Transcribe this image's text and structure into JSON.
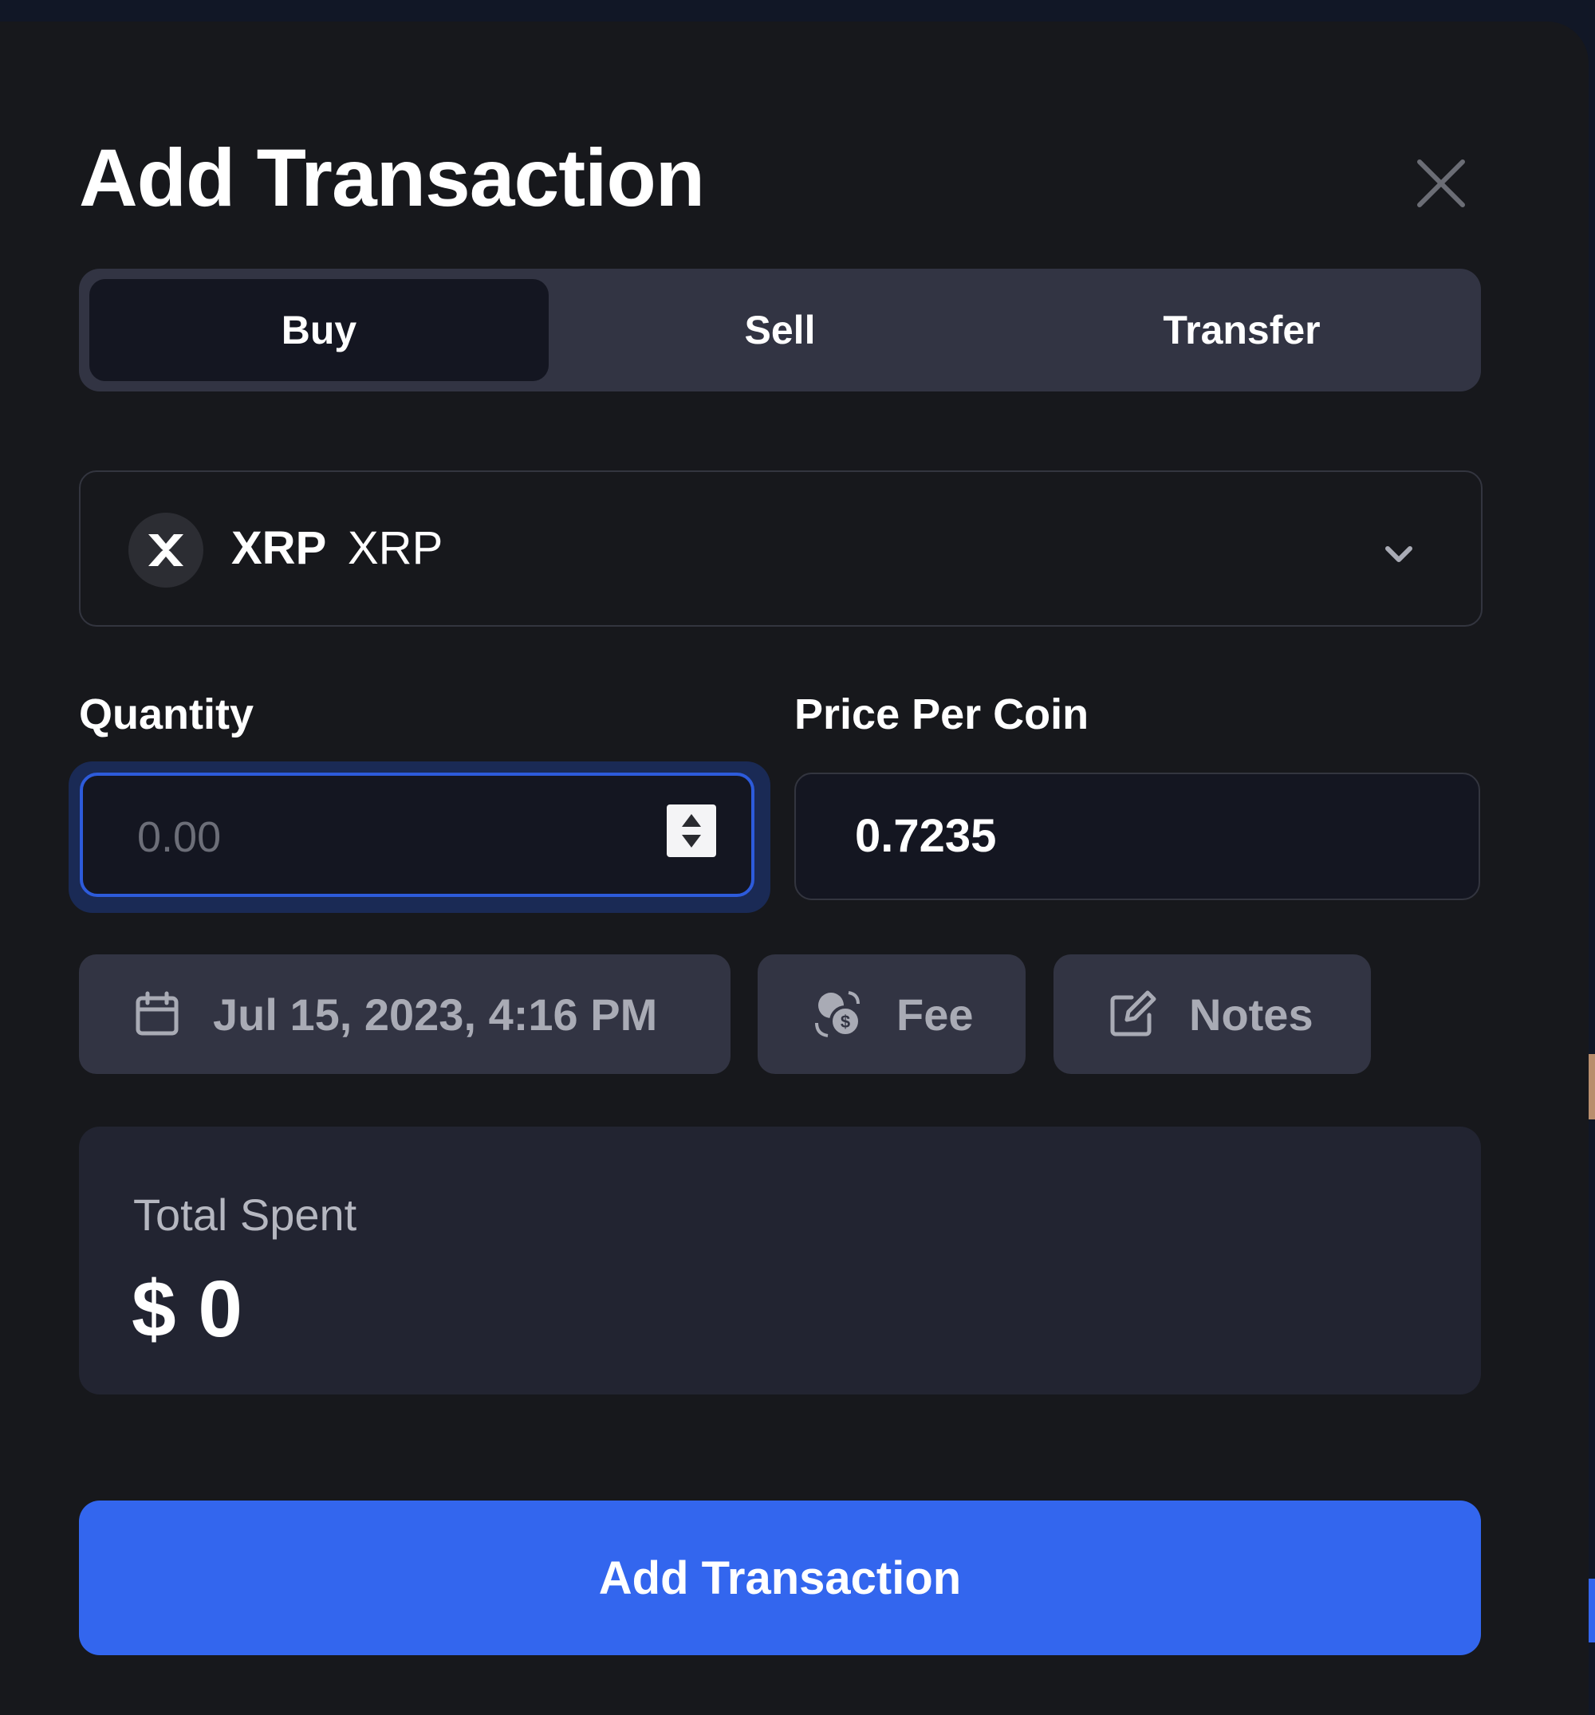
{
  "modal": {
    "title": "Add Transaction",
    "close_icon": "close-icon"
  },
  "tabs": [
    {
      "label": "Buy",
      "active": true
    },
    {
      "label": "Sell",
      "active": false
    },
    {
      "label": "Transfer",
      "active": false
    }
  ],
  "coin": {
    "symbol": "XRP",
    "name": "XRP",
    "icon": "xrp-logo-icon",
    "dropdown_icon": "chevron-down-icon"
  },
  "quantity": {
    "label": "Quantity",
    "placeholder": "0.00",
    "value": ""
  },
  "price_per_coin": {
    "label": "Price Per Coin",
    "value": "0.7235"
  },
  "chips": {
    "date": {
      "label": "Jul 15, 2023, 4:16 PM",
      "icon": "calendar-icon"
    },
    "fee": {
      "label": "Fee",
      "icon": "coins-icon"
    },
    "notes": {
      "label": "Notes",
      "icon": "edit-icon"
    }
  },
  "total": {
    "label": "Total Spent",
    "value": "$ 0"
  },
  "submit": {
    "label": "Add Transaction"
  },
  "colors": {
    "modal_bg": "#17181c",
    "accent": "#3366ee",
    "tab_track": "#323443",
    "tab_active": "#141621",
    "focus_border": "#2d5bdb"
  }
}
